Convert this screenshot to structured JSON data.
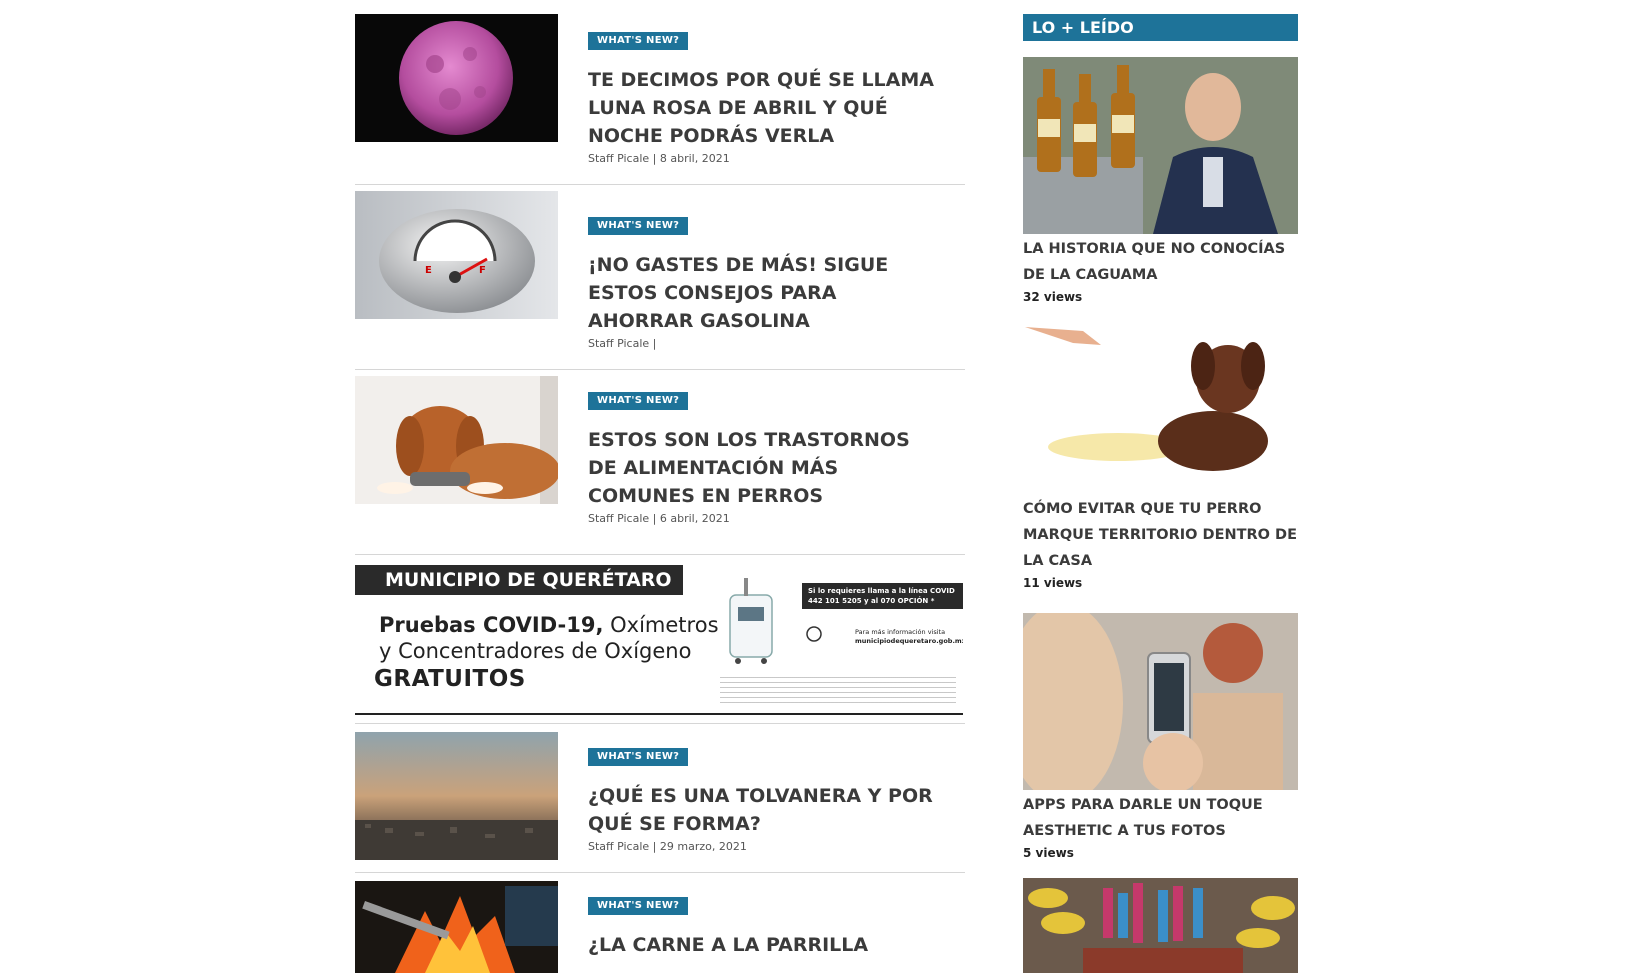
{
  "articles": [
    {
      "badge": "WHAT'S NEW?",
      "title": "TE DECIMOS POR QUÉ SE LLAMA LUNA ROSA DE ABRIL Y QUÉ NOCHE PODRÁS VERLA",
      "meta": "Staff Picale | 8 abril, 2021",
      "image": "pink-moon-image"
    },
    {
      "badge": "WHAT'S NEW?",
      "title": "¡NO GASTES DE MÁS! SIGUE ESTOS CONSEJOS PARA AHORRAR GASOLINA",
      "meta": "Staff Picale |",
      "image": "piggy-fuel-gauge-image"
    },
    {
      "badge": "WHAT'S NEW?",
      "title": "ESTOS SON LOS TRASTORNOS DE ALIMENTACIÓN MÁS COMUNES EN PERROS",
      "meta": "Staff Picale | 6 abril, 2021",
      "image": "dog-eating-image"
    },
    {
      "badge": "WHAT'S NEW?",
      "title": "¿QUÉ ES UNA TOLVANERA Y POR QUÉ SE FORMA?",
      "meta": "Staff Picale | 29 marzo, 2021",
      "image": "dusty-city-image"
    },
    {
      "badge": "WHAT'S NEW?",
      "title": "¿LA CARNE A LA PARRILLA",
      "meta": "",
      "image": "grill-fire-image"
    }
  ],
  "ad": {
    "header": "MUNICIPIO DE QUERÉTARO",
    "line1_bold": "Pruebas COVID-19,",
    "line1_rest": " Oxímetros",
    "line2": "y Concentradores de Oxígeno",
    "line3": "GRATUITOS",
    "covid_line1": "Si lo requieres llama a la línea COVID",
    "covid_line2": "442 101 5205 y al 070 OPCIÓN *",
    "info_line1": "Para más información visita",
    "info_line2": "municipiodequeretaro.gob.mx"
  },
  "sidebar": {
    "heading": "LO + LEÍDO",
    "items": [
      {
        "title": "LA HISTORIA QUE NO CONOCÍAS DE LA CAGUAMA",
        "views": "32 views",
        "image": "beer-bottles-man-image"
      },
      {
        "title": "CÓMO EVITAR QUE TU PERRO MARQUE TERRITORIO DENTRO DE LA CASA",
        "views": "11 views",
        "image": "dog-puddle-image"
      },
      {
        "title": "APPS PARA DARLE UN TOQUE AESTHETIC A TUS FOTOS",
        "views": "5 views",
        "image": "phone-photo-image"
      },
      {
        "title": "",
        "views": "",
        "image": "market-fruit-image"
      }
    ]
  },
  "colors": {
    "accent": "#1e7399",
    "title": "#3b3b3b"
  }
}
